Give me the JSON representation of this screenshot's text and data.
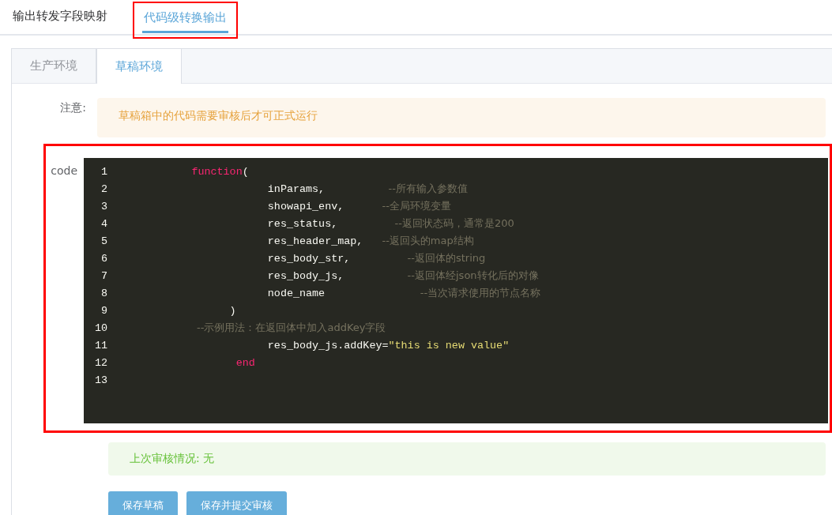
{
  "top_tabs": [
    {
      "label": "输出转发字段映射",
      "selected": false,
      "highlighted": false
    },
    {
      "label": "代码级转换输出",
      "selected": true,
      "highlighted": true
    }
  ],
  "env_tabs": [
    {
      "label": "生产环境",
      "selected": false
    },
    {
      "label": "草稿环境",
      "selected": true
    }
  ],
  "notice": {
    "label": "注意:",
    "text": "草稿箱中的代码需要审核后才可正式运行"
  },
  "code": {
    "label": "code",
    "highlighted": true,
    "lines": [
      {
        "number": "1",
        "segments": [
          {
            "kind": "keyword",
            "text": "           function"
          },
          {
            "kind": "plain",
            "text": "("
          }
        ]
      },
      {
        "number": "2",
        "segments": [
          {
            "kind": "plain",
            "text": "                       inParams,          "
          },
          {
            "kind": "comment",
            "text": "--所有输入参数值"
          }
        ]
      },
      {
        "number": "3",
        "segments": [
          {
            "kind": "plain",
            "text": "                       showapi_env,      "
          },
          {
            "kind": "comment",
            "text": "--全局环境变量"
          }
        ]
      },
      {
        "number": "4",
        "segments": [
          {
            "kind": "plain",
            "text": "                       res_status,         "
          },
          {
            "kind": "comment",
            "text": "--返回状态码，通常是200"
          }
        ]
      },
      {
        "number": "5",
        "segments": [
          {
            "kind": "plain",
            "text": "                       res_header_map,   "
          },
          {
            "kind": "comment",
            "text": "--返回头的map结构"
          }
        ]
      },
      {
        "number": "6",
        "segments": [
          {
            "kind": "plain",
            "text": "                       res_body_str,         "
          },
          {
            "kind": "comment",
            "text": "--返回体的string"
          }
        ]
      },
      {
        "number": "7",
        "segments": [
          {
            "kind": "plain",
            "text": "                       res_body_js,          "
          },
          {
            "kind": "comment",
            "text": "--返回体经json转化后的对像"
          }
        ]
      },
      {
        "number": "8",
        "segments": [
          {
            "kind": "plain",
            "text": "                       node_name               "
          },
          {
            "kind": "comment",
            "text": "--当次请求使用的节点名称"
          }
        ]
      },
      {
        "number": "9",
        "segments": [
          {
            "kind": "plain",
            "text": "                 )"
          }
        ]
      },
      {
        "number": "10",
        "segments": [
          {
            "kind": "comment",
            "text": "                       --示例用法：在返回体中加入addKey字段"
          }
        ]
      },
      {
        "number": "11",
        "segments": [
          {
            "kind": "plain",
            "text": "                       res_body_js.addKey="
          },
          {
            "kind": "string",
            "text": "\"this is new value\""
          }
        ]
      },
      {
        "number": "12",
        "segments": [
          {
            "kind": "keyword",
            "text": "                  end"
          }
        ]
      },
      {
        "number": "13"
      }
    ]
  },
  "review": {
    "text": "上次审核情况: 无"
  },
  "buttons": [
    "保存草稿",
    "保存并提交审核"
  ]
}
